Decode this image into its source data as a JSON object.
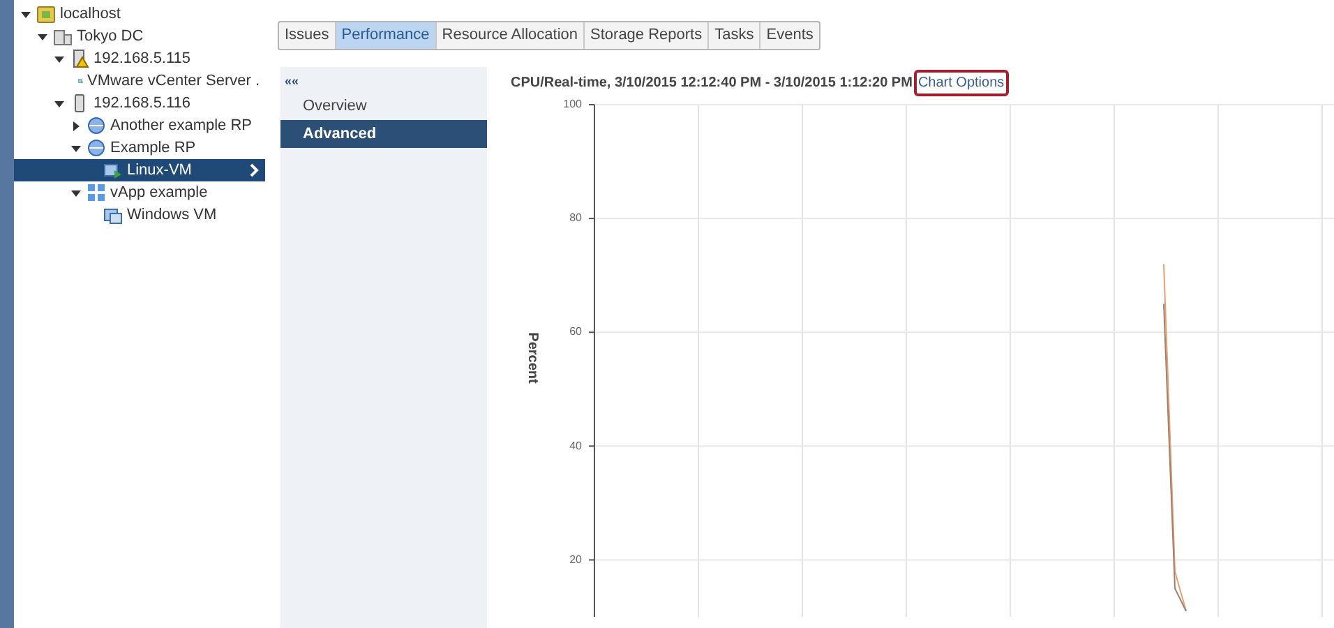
{
  "tree": [
    {
      "label": "localhost",
      "kind": "host-folder",
      "expanded": true,
      "selected": false,
      "children": [
        {
          "label": "Tokyo DC",
          "kind": "datacenter",
          "expanded": true,
          "selected": false,
          "children": [
            {
              "label": "192.168.5.115",
              "kind": "host-warning",
              "expanded": true,
              "selected": false,
              "children": [
                {
                  "label": "VMware vCenter Server .",
                  "kind": "vm",
                  "selected": false
                }
              ]
            },
            {
              "label": "192.168.5.116",
              "kind": "host",
              "expanded": true,
              "selected": false,
              "children": [
                {
                  "label": "Another example RP",
                  "kind": "pool",
                  "expanded": false,
                  "selected": false
                },
                {
                  "label": "Example RP",
                  "kind": "pool",
                  "expanded": true,
                  "selected": false,
                  "children": [
                    {
                      "label": "Linux-VM",
                      "kind": "vm",
                      "selected": true
                    }
                  ]
                },
                {
                  "label": "vApp example",
                  "kind": "vapp",
                  "expanded": true,
                  "selected": false,
                  "children": [
                    {
                      "label": "Windows VM",
                      "kind": "vm-off",
                      "selected": false
                    }
                  ]
                }
              ]
            }
          ]
        }
      ]
    }
  ],
  "tabs": [
    {
      "label": "Issues",
      "selected": false
    },
    {
      "label": "Performance",
      "selected": true
    },
    {
      "label": "Resource Allocation",
      "selected": false
    },
    {
      "label": "Storage Reports",
      "selected": false
    },
    {
      "label": "Tasks",
      "selected": false
    },
    {
      "label": "Events",
      "selected": false
    }
  ],
  "side_nav": {
    "collapse": "««",
    "items": [
      {
        "label": "Overview",
        "selected": false
      },
      {
        "label": "Advanced",
        "selected": true
      }
    ]
  },
  "chart_title": "CPU/Real-time, 3/10/2015 12:12:40 PM - 3/10/2015 1:12:20 PM",
  "chart_options": "Chart Options",
  "chart_data": {
    "type": "line",
    "grid": true,
    "ylabel": "Percent",
    "ylim": [
      10,
      100
    ],
    "yticks": [
      20,
      40,
      60,
      80,
      100
    ],
    "categories": [
      null,
      null,
      null,
      null,
      null,
      null,
      null,
      null,
      null,
      null,
      null,
      null,
      null,
      null,
      null,
      null,
      null,
      null,
      null,
      null,
      null,
      null,
      null,
      null,
      null,
      null,
      null,
      null,
      null,
      null,
      null,
      null,
      null,
      null,
      null,
      null,
      null,
      null,
      null,
      null,
      null,
      null,
      null,
      null,
      null,
      null,
      null,
      null,
      null,
      null,
      null,
      null,
      null,
      null,
      null,
      null,
      null,
      null,
      null,
      null,
      null,
      null,
      null,
      null,
      null,
      null,
      null,
      null,
      null
    ],
    "series": [
      {
        "color": "#e8a070",
        "values": [
          null,
          null,
          null,
          null,
          null,
          null,
          null,
          null,
          null,
          null,
          null,
          null,
          null,
          null,
          null,
          null,
          null,
          null,
          null,
          null,
          null,
          null,
          null,
          null,
          null,
          null,
          null,
          null,
          null,
          null,
          null,
          null,
          null,
          null,
          null,
          null,
          null,
          null,
          null,
          null,
          null,
          null,
          null,
          null,
          null,
          null,
          null,
          null,
          null,
          null,
          null,
          72,
          18,
          11,
          null,
          null,
          null,
          null,
          null,
          null,
          null,
          null,
          null,
          null,
          null,
          null,
          null,
          null,
          null
        ]
      },
      {
        "color": "#a08070",
        "values": [
          null,
          null,
          null,
          null,
          null,
          null,
          null,
          null,
          null,
          null,
          null,
          null,
          null,
          null,
          null,
          null,
          null,
          null,
          null,
          null,
          null,
          null,
          null,
          null,
          null,
          null,
          null,
          null,
          null,
          null,
          null,
          null,
          null,
          null,
          null,
          null,
          null,
          null,
          null,
          null,
          null,
          null,
          null,
          null,
          null,
          null,
          null,
          null,
          null,
          null,
          null,
          65,
          15,
          11,
          null,
          null,
          null,
          null,
          null,
          null,
          null,
          null,
          null,
          null,
          null,
          null,
          null,
          null,
          null
        ]
      }
    ]
  }
}
